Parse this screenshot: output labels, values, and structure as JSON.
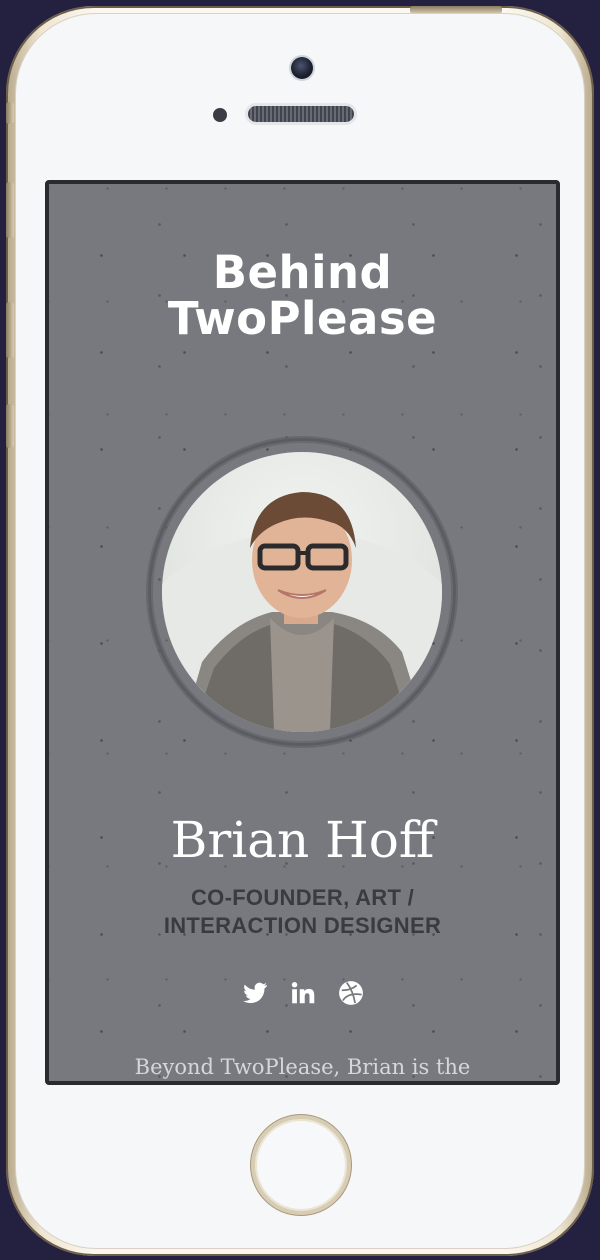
{
  "header": {
    "title_line1": "Behind",
    "title_line2": "TwoPlease"
  },
  "profile": {
    "name": "Brian Hoff",
    "role_line1": "CO-FOUNDER, ART /",
    "role_line2": "INTERACTION DESIGNER",
    "bio_text": "Beyond TwoPlease, Brian is the"
  },
  "social": [
    {
      "icon": "twitter-icon"
    },
    {
      "icon": "linkedin-icon"
    },
    {
      "icon": "dribbble-icon"
    }
  ],
  "colors": {
    "screen_background": "#78797e",
    "headline": "#ffffff",
    "role_text": "#3a3b40",
    "bio_text": "#d6d7db",
    "page_background": "#24203f"
  }
}
